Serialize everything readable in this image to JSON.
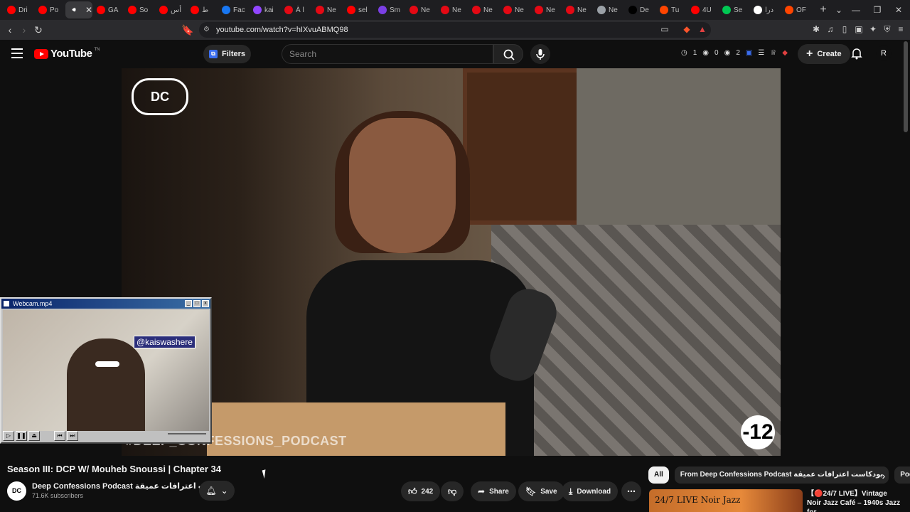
{
  "browser": {
    "tabs": [
      {
        "label": "Dri",
        "color": "#ff0000"
      },
      {
        "label": "Po",
        "color": "#ff0000"
      },
      {
        "label": "",
        "color": "#5f6368",
        "active": true
      },
      {
        "label": "GA",
        "color": "#ff0000"
      },
      {
        "label": "So",
        "color": "#ff0000"
      },
      {
        "label": "أس",
        "color": "#ff0000"
      },
      {
        "label": "ط",
        "color": "#ff0000"
      },
      {
        "label": "Fac",
        "color": "#1877f2"
      },
      {
        "label": "kai",
        "color": "#9146ff"
      },
      {
        "label": "À l",
        "color": "#e50914"
      },
      {
        "label": "Ne",
        "color": "#e50914"
      },
      {
        "label": "sel",
        "color": "#ff0000"
      },
      {
        "label": "Sm",
        "color": "#7b3fe4"
      },
      {
        "label": "Ne",
        "color": "#e50914"
      },
      {
        "label": "Ne",
        "color": "#e50914"
      },
      {
        "label": "Ne",
        "color": "#e50914"
      },
      {
        "label": "Ne",
        "color": "#e50914"
      },
      {
        "label": "Ne",
        "color": "#e50914"
      },
      {
        "label": "Ne",
        "color": "#e50914"
      },
      {
        "label": "Ne",
        "color": "#9aa0a6"
      },
      {
        "label": "De",
        "color": "#000000"
      },
      {
        "label": "Tu",
        "color": "#ff4500"
      },
      {
        "label": "4U",
        "color": "#ff0000"
      },
      {
        "label": "Se",
        "color": "#00c853"
      },
      {
        "label": "درا",
        "color": "#ffffff"
      },
      {
        "label": "OF",
        "color": "#ff4500"
      }
    ],
    "url": "youtube.com/watch?v=hIXvuABMQ98"
  },
  "header": {
    "logo": "YouTube",
    "logo_super": "TN",
    "filters_label": "Filters",
    "search_placeholder": "Search",
    "counters": [
      "1",
      "0",
      "2"
    ],
    "create_label": "Create",
    "avatar_letter": "R"
  },
  "player": {
    "channel_logo_text": "DC",
    "watermark": "#DEEP_CONFESSIONS_PODCAST",
    "age_rating": "-12"
  },
  "webcam": {
    "title": "Webcam.mp4",
    "handle": "@kaiswashere"
  },
  "video": {
    "title": "Season III: DCP W/ Mouheb Snoussi | Chapter 34",
    "channel": "Deep Confessions Podcast  بودكاست اعترافات عميقة",
    "subscribers": "71.6K subscribers",
    "channel_avatar": "DC",
    "likes": "242",
    "share_label": "Share",
    "save_label": "Save",
    "download_label": "Download"
  },
  "sidebar": {
    "chips": [
      "All",
      "From Deep Confessions Podcast  بودكاست اعترافات عميقة",
      "Podcast"
    ],
    "recommended": {
      "thumb_text": "24/7 LIVE Noir Jazz",
      "title": "【🔴24/7 LIVE】Vintage Noir Jazz Café – 1940s Jazz for"
    }
  }
}
